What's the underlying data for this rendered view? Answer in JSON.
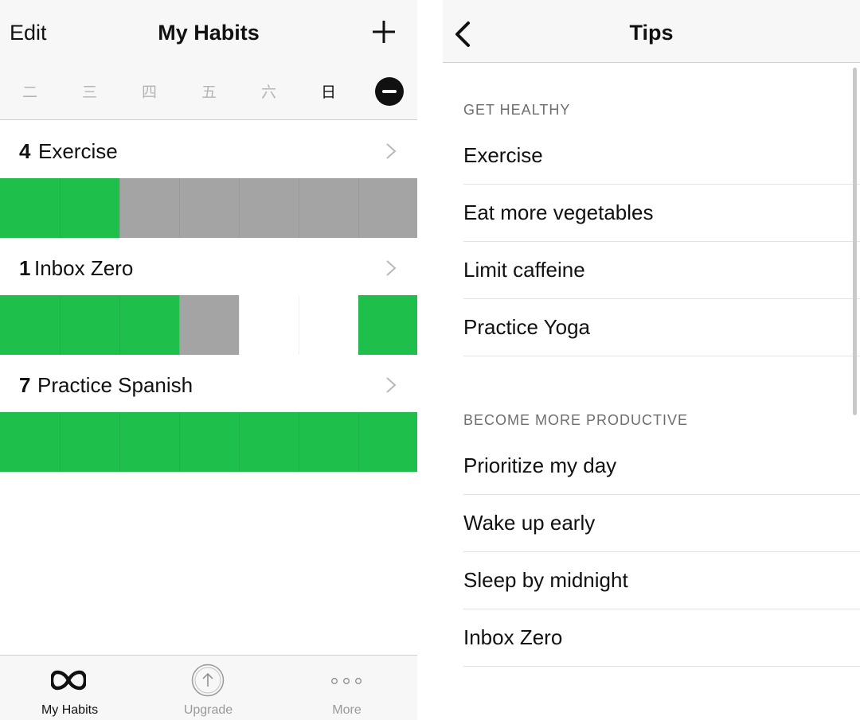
{
  "left": {
    "nav": {
      "edit_label": "Edit",
      "title": "My Habits",
      "add_icon": "plus-icon"
    },
    "days": [
      "二",
      "三",
      "四",
      "五",
      "六",
      "日"
    ],
    "habits": [
      {
        "count": "4",
        "name": "Exercise",
        "cells": [
          "done",
          "done",
          "missed",
          "missed",
          "missed",
          "missed",
          "missed"
        ]
      },
      {
        "count": "1",
        "name": "Inbox Zero",
        "cells": [
          "done",
          "done",
          "done",
          "missed",
          "empty",
          "empty",
          "done"
        ]
      },
      {
        "count": "7",
        "name": "Practice Spanish",
        "cells": [
          "done",
          "done",
          "done",
          "done",
          "done",
          "done",
          "done"
        ]
      }
    ],
    "tabs": [
      {
        "label": "My Habits",
        "icon": "infinity-icon",
        "active": true
      },
      {
        "label": "Upgrade",
        "icon": "upload-arrow-icon",
        "active": false
      },
      {
        "label": "More",
        "icon": "ellipsis-icon",
        "active": false
      }
    ]
  },
  "right": {
    "nav": {
      "title": "Tips",
      "back_icon": "chevron-left-icon"
    },
    "sections": [
      {
        "header": "GET HEALTHY",
        "items": [
          "Exercise",
          "Eat more vegetables",
          "Limit caffeine",
          "Practice Yoga"
        ]
      },
      {
        "header": "BECOME MORE PRODUCTIVE",
        "items": [
          "Prioritize my day",
          "Wake up early",
          "Sleep by midnight",
          "Inbox Zero"
        ]
      }
    ]
  },
  "colors": {
    "done": "#1fbf4c",
    "missed": "#a4a4a4",
    "empty": "#ffffff"
  }
}
